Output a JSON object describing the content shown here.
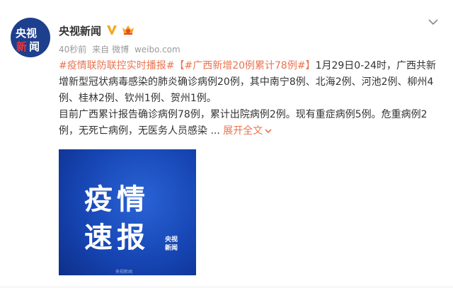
{
  "post": {
    "avatar_line1": "央视",
    "avatar_line2a": "新",
    "avatar_line2b": "闻",
    "username": "央视新闻",
    "time": "40秒前",
    "source_prefix": "来自",
    "source": "微博",
    "source_url": "weibo.com",
    "hashtag1": "#疫情联防联控实时播报#",
    "hashtag2": "【#广西新增20例累计78例#】",
    "body1": "1月29日0-24时，广西共新增新型冠状病毒感染的肺炎确诊病例20例，其中南宁8例、北海2例、河池2例、柳州4例、桂林2例、钦州1例、贺州1例。",
    "body2": "目前广西累计报告确诊病例78例，累计出院病例2例。现有重症病例5例。危重病例2例，无死亡病例，无医务人员感染 ... ",
    "expand": "展开全文",
    "expand_icon": "chevron-down",
    "image": {
      "line1": "疫情",
      "line2": "速报",
      "logo1": "央视",
      "logo2": "新闻",
      "footer": "央视新闻"
    }
  },
  "colors": {
    "link": "#eb7350",
    "image_bg": "#1543b0",
    "verified": "#f5a623"
  }
}
